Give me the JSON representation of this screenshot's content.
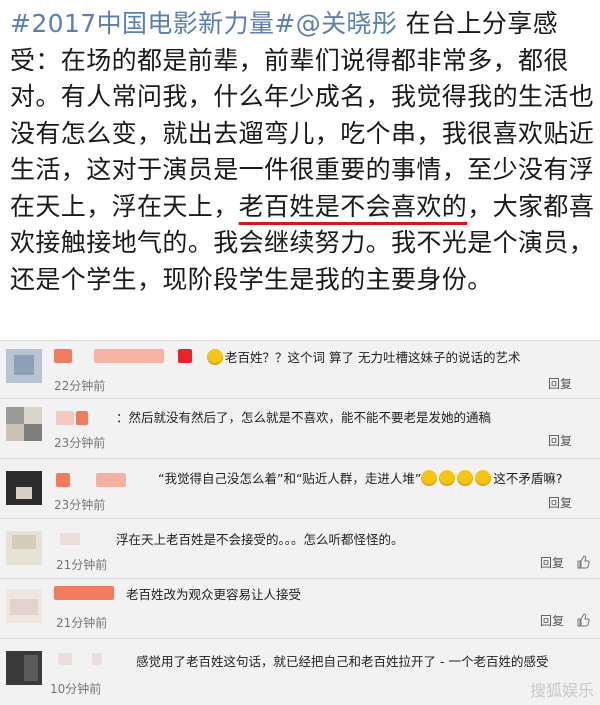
{
  "post": {
    "hashtag": "#2017中国电影新力量#",
    "mention": "@关晓彤",
    "text_a": " 在台上分享感受：在场的都是前辈，前辈们说得都非常多，都很对。有人常问我，什么年少成名，我觉得我的生活也没有怎么变，就出去遛弯儿，吃个串，我很喜欢贴近生活，这对于演员是一件很重要的事情，至少没有浮在天上，浮在天上，",
    "underlined": "老百姓是不会喜欢的",
    "text_b": "，大家都喜欢接触接地气的。我会继续努力。我不光是个演员，还是个学生，现阶段学生是我的主要身份。"
  },
  "comments": [
    {
      "text": "老百姓？？这个词 算了 无力吐槽这妹子的说话的艺术",
      "has_lead_emoji": true,
      "time": "22分钟前",
      "reply": "回复"
    },
    {
      "text": "：然后就没有然后了，怎么就是不喜欢，能不能不要老是发她的通稿",
      "has_lead_emoji": false,
      "time": "23分钟前",
      "reply": "回复"
    },
    {
      "text": "“我觉得自己没怎么着”和“贴近人群，走进人堆”",
      "text_tail": "这不矛盾嘛?",
      "trailing_emoji_count": 4,
      "time": "23分钟前",
      "reply": "回复"
    },
    {
      "text": "浮在天上老百姓是不会接受的。。。怎么听都怪怪的。",
      "time": "21分钟前",
      "reply": "回复"
    },
    {
      "text": "老百姓改为观众更容易让人接受",
      "time": "21分钟前",
      "reply": "回复"
    },
    {
      "text": "感觉用了老百姓这句话，就已经把自己和老百姓拉开了 - 一个老百姓的感受",
      "time": "10分钟前",
      "reply": "回复"
    }
  ],
  "watermark": "搜狐娱乐",
  "colors": {
    "link": "#5b7fb0",
    "underline": "#d9161c",
    "comments_bg": "#f2f2f2"
  }
}
